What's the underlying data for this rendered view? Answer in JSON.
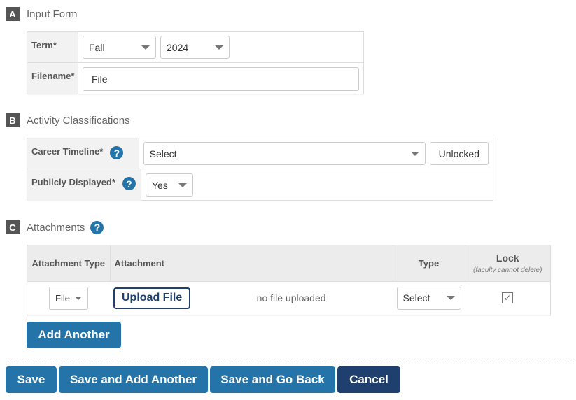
{
  "sections": {
    "a": {
      "badge": "A",
      "title": "Input Form"
    },
    "b": {
      "badge": "B",
      "title": "Activity Classifications"
    },
    "c": {
      "badge": "C",
      "title": "Attachments"
    }
  },
  "input_form": {
    "term_label": "Term*",
    "term_season": "Fall",
    "term_year": "2024",
    "filename_label": "Filename*",
    "filename_value": "File"
  },
  "classifications": {
    "career_label": "Career Timeline*",
    "career_value": "Select",
    "lock_button": "Unlocked",
    "public_label": "Publicly Displayed*",
    "public_value": "Yes"
  },
  "help_glyph": "?",
  "attachments": {
    "headers": {
      "type": "Attachment Type",
      "attachment": "Attachment",
      "doc_type": "Type",
      "lock": "Lock",
      "lock_note": "(faculty cannot delete)"
    },
    "rows": [
      {
        "type": "File",
        "upload_label": "Upload File",
        "status": "no file uploaded",
        "doc_type": "Select",
        "lock_checked": true,
        "check_glyph": "✓"
      }
    ],
    "add_another": "Add Another"
  },
  "footer": {
    "save": "Save",
    "save_add": "Save and Add Another",
    "save_back": "Save and Go Back",
    "cancel": "Cancel"
  }
}
